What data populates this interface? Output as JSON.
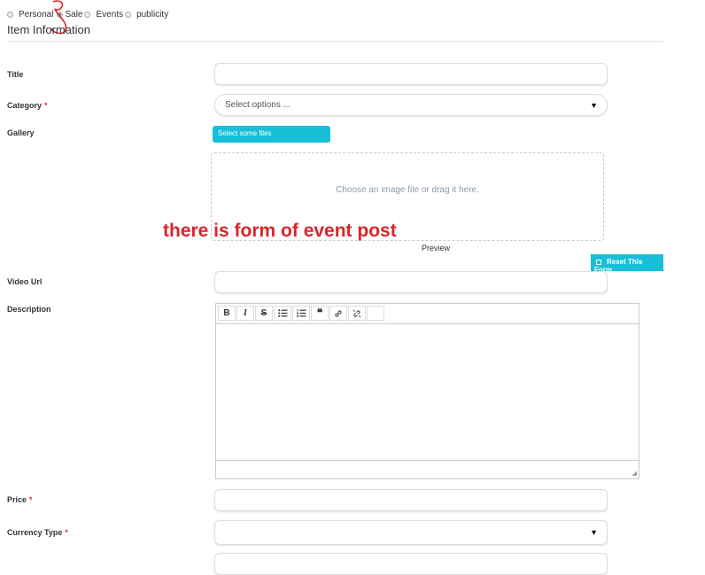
{
  "post_types": [
    {
      "label": "Personal",
      "checked": false
    },
    {
      "label": "Sale",
      "checked": true
    },
    {
      "label": "Events",
      "checked": false
    },
    {
      "label": "publicity",
      "checked": false
    }
  ],
  "section_title": "Item Information",
  "fields": {
    "title": {
      "label": "Title"
    },
    "category": {
      "label": "Category",
      "required": "*",
      "placeholder": "Select options ..."
    },
    "gallery": {
      "label": "Gallery",
      "button": "Select some files",
      "dropzone_text": "Choose an image file or drag it here.",
      "preview": "Preview"
    },
    "video_url": {
      "label": "Video Url"
    },
    "description": {
      "label": "Description"
    },
    "price": {
      "label": "Price",
      "required": "*"
    },
    "currency_type": {
      "label": "Currency Type",
      "required": "*"
    }
  },
  "reset_button": "Reset This Form",
  "annotation": "there  is form of event  post",
  "toolbar": {
    "bold": "B",
    "italic": "I",
    "strike": "S",
    "bullets": "ul",
    "numbers": "ol",
    "quote": "66",
    "link": "link",
    "unlink": "unlink"
  },
  "colors": {
    "accent": "#17bfd7",
    "annotation": "#d9252c",
    "required": "#d9342b"
  }
}
